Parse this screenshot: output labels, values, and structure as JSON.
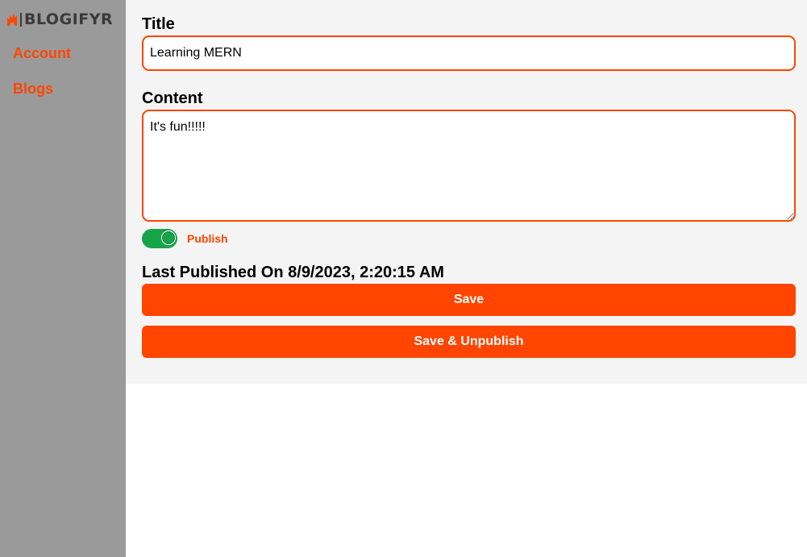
{
  "sidebar": {
    "logo_text": "BLOGIFYR",
    "logo_icon": "flame-icon",
    "items": [
      {
        "label": "Account"
      },
      {
        "label": "Blogs"
      }
    ]
  },
  "form": {
    "title_label": "Title",
    "title_value": "Learning MERN",
    "content_label": "Content",
    "content_value": "It's fun!!!!!",
    "publish_toggle": {
      "label": "Publish",
      "checked": true
    },
    "last_published": "Last Published On 8/9/2023, 2:20:15 AM",
    "save_label": "Save",
    "save_unpublish_label": "Save & Unpublish"
  },
  "colors": {
    "accent": "#ff4500",
    "toggle_on": "#17a34a",
    "sidebar_bg": "#9a9a9a",
    "main_bg": "#f4f4f4"
  }
}
